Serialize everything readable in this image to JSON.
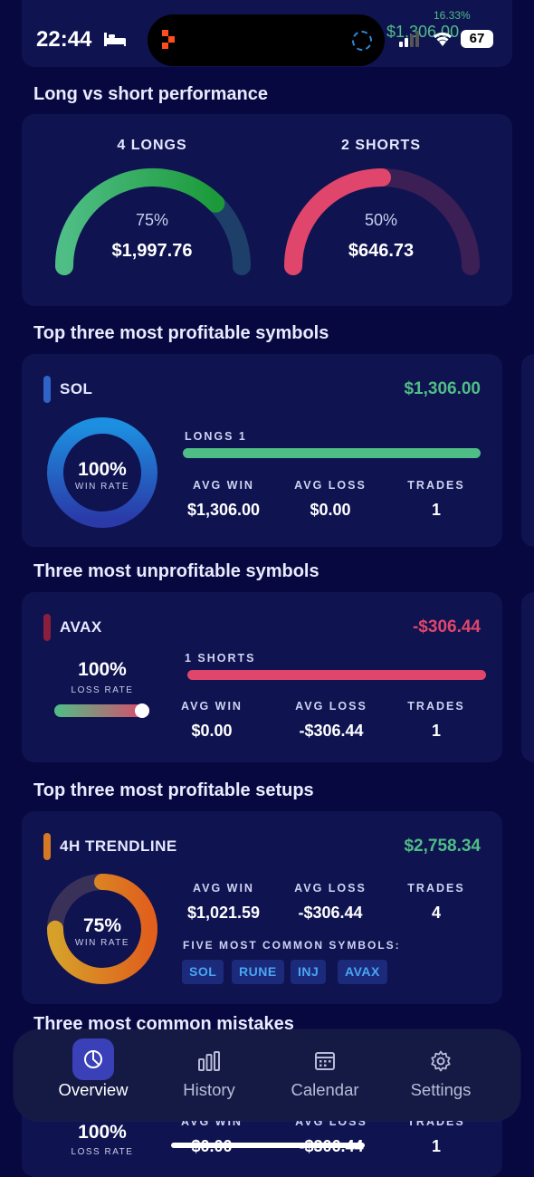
{
  "status_bar": {
    "time": "22:44",
    "battery": "67",
    "peek_percent": "16.33%",
    "peek_value": "$1,306.00"
  },
  "long_short": {
    "title": "Long vs short performance",
    "longs": {
      "label": "4 LONGS",
      "percent": "75%",
      "value": "$1,997.76",
      "ratio": 0.75,
      "color": "#4fbe86"
    },
    "shorts": {
      "label": "2 SHORTS",
      "percent": "50%",
      "value": "$646.73",
      "ratio": 0.5,
      "color": "#e0466b"
    }
  },
  "profitable_symbols": {
    "title": "Top three most profitable symbols",
    "symbol": "SOL",
    "pnl": "$1,306.00",
    "rate_value": "100%",
    "rate_label": "WIN RATE",
    "bar_label": "LONGS 1",
    "stats": [
      {
        "label": "AVG WIN",
        "value": "$1,306.00"
      },
      {
        "label": "AVG LOSS",
        "value": "$0.00"
      },
      {
        "label": "TRADES",
        "value": "1"
      }
    ]
  },
  "unprofitable_symbols": {
    "title": "Three most unprofitable symbols",
    "symbol": "AVAX",
    "pnl": "-$306.44",
    "rate_value": "100%",
    "rate_label": "LOSS RATE",
    "loss_rate_fraction": 1.0,
    "bar_label": "1 SHORTS",
    "stats": [
      {
        "label": "AVG WIN",
        "value": "$0.00"
      },
      {
        "label": "AVG LOSS",
        "value": "-$306.44"
      },
      {
        "label": "TRADES",
        "value": "1"
      }
    ]
  },
  "profitable_setups": {
    "title": "Top three most profitable setups",
    "setup": "4H TRENDLINE",
    "pnl": "$2,758.34",
    "rate_value": "75%",
    "rate_label": "WIN RATE",
    "win_rate_fraction": 0.75,
    "stats": [
      {
        "label": "AVG WIN",
        "value": "$1,021.59"
      },
      {
        "label": "AVG LOSS",
        "value": "-$306.44"
      },
      {
        "label": "TRADES",
        "value": "4"
      }
    ],
    "common_label": "FIVE MOST COMMON SYMBOLS:",
    "symbols": [
      "SOL",
      "RUNE",
      "INJ",
      "AVAX"
    ]
  },
  "mistakes": {
    "title": "Three most common mistakes",
    "rate_value": "100%",
    "rate_label": "LOSS RATE",
    "stats": [
      {
        "label": "AVG WIN",
        "value": "$0.00"
      },
      {
        "label": "AVG LOSS",
        "value": "-$306.44"
      },
      {
        "label": "TRADES",
        "value": "1"
      }
    ]
  },
  "nav": {
    "items": [
      {
        "label": "Overview",
        "icon": "pie-chart-icon",
        "active": true
      },
      {
        "label": "History",
        "icon": "bar-chart-icon",
        "active": false
      },
      {
        "label": "Calendar",
        "icon": "calendar-icon",
        "active": false
      },
      {
        "label": "Settings",
        "icon": "gear-icon",
        "active": false
      }
    ]
  }
}
